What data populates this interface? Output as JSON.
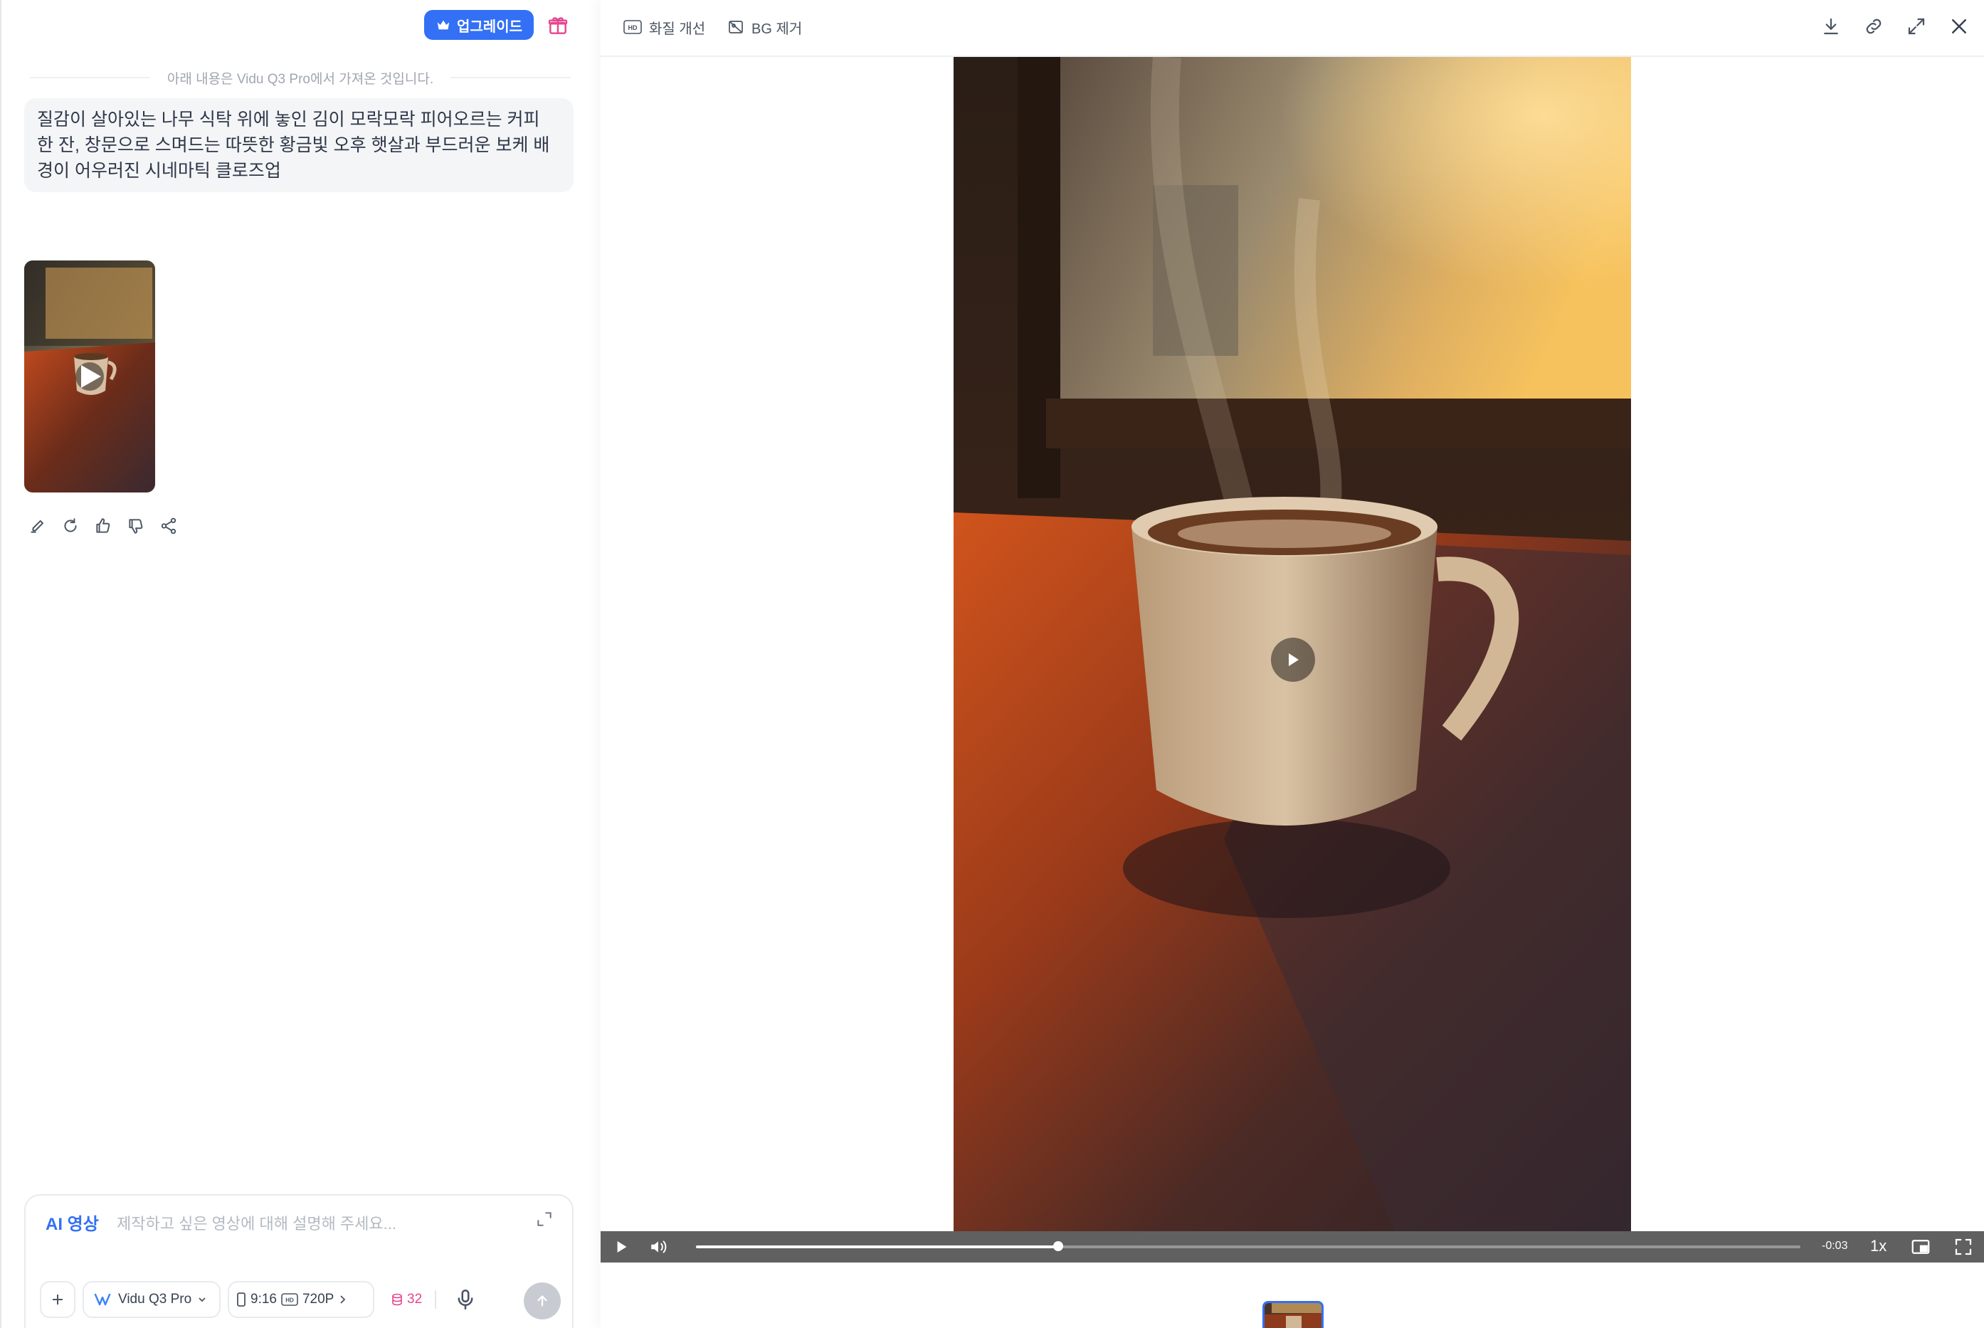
{
  "header": {
    "upgrade_label": "업그레이드"
  },
  "chat": {
    "from_note": "아래 내용은 Vidu Q3 Pro에서 가져온 것입니다.",
    "prompt_text": "질감이 살아있는 나무 식탁 위에 놓인 김이 모락모락 피어오르는 커피 한 잔, 창문으로 스며드는 따뜻한 황금빛 오후 햇살과 부드러운 보케 배경이 어우러진 시네마틱 클로즈업",
    "actions": [
      "edit-icon",
      "regenerate-icon",
      "thumbs-up-icon",
      "thumbs-down-icon",
      "share-icon"
    ]
  },
  "composer": {
    "mode_label": "AI 영상",
    "placeholder": "제작하고 싶은 영상에 대해 설명해 주세요...",
    "model_label": "Vidu Q3 Pro",
    "aspect_label": "9:16",
    "resolution_label": "720P",
    "credits": "32"
  },
  "viewer": {
    "tools": {
      "enhance_label": "화질 개선",
      "bg_remove_label": "BG 제거"
    },
    "top_icons": [
      "download-icon",
      "link-icon",
      "expand-icon",
      "close-icon"
    ],
    "player": {
      "time_remaining": "-0:03",
      "speed": "1x",
      "progress": 0.328
    }
  },
  "colors": {
    "accent": "#3370f5",
    "credits": "#e8458f"
  }
}
